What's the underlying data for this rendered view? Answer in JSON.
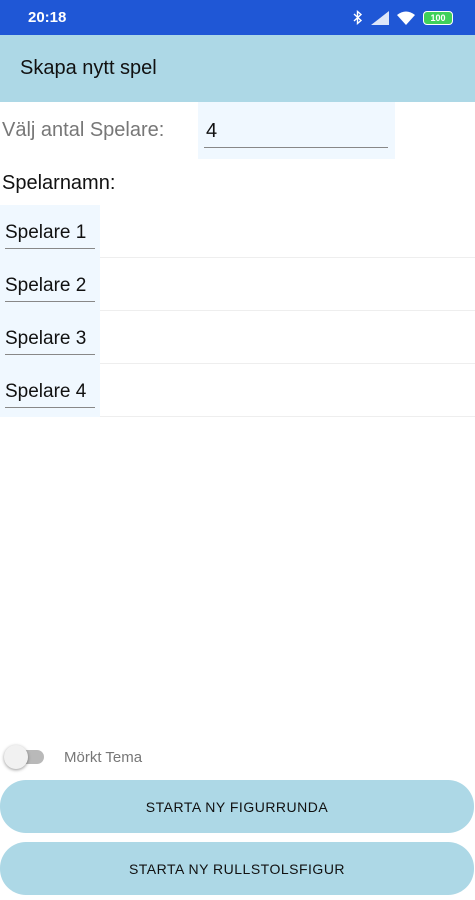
{
  "status_bar": {
    "time": "20:18",
    "battery": "100",
    "icons": [
      "bluetooth-icon",
      "signal-icon",
      "wifi-icon",
      "battery-icon"
    ]
  },
  "app_bar": {
    "title": "Skapa nytt spel"
  },
  "player_count": {
    "label": "Välj antal Spelare:",
    "value": "4"
  },
  "players": {
    "heading": "Spelarnamn:",
    "items": [
      {
        "value": "Spelare 1"
      },
      {
        "value": "Spelare 2"
      },
      {
        "value": "Spelare 3"
      },
      {
        "value": "Spelare 4"
      }
    ]
  },
  "theme": {
    "label": "Mörkt Tema",
    "enabled": false
  },
  "buttons": {
    "start_figure_round": "STARTA NY FIGURRUNDA",
    "start_wheelchair_figure": "STARTA NY RULLSTOLSFIGUR"
  },
  "colors": {
    "status_bar": "#1f57d6",
    "app_bar": "#add8e6",
    "input_background": "#f0f8ff",
    "button": "#add8e6"
  }
}
